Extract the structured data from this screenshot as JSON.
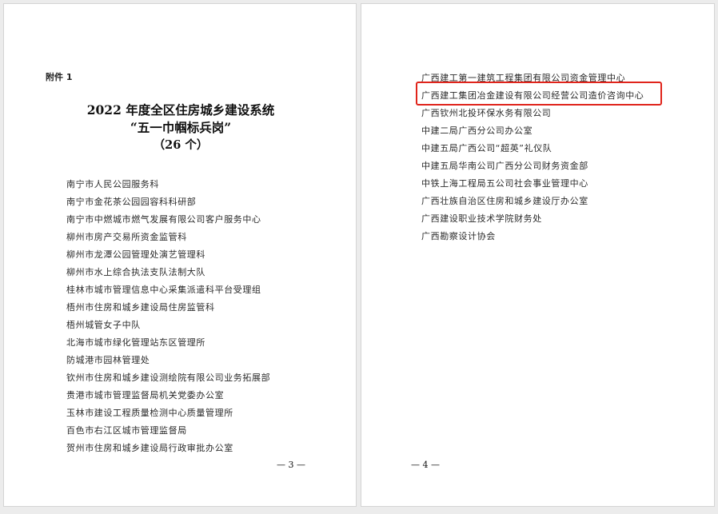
{
  "left_page": {
    "attachment_label": "附件 1",
    "title_line1": "2022 年度全区住房城乡建设系统",
    "title_line2": "“五一巾帼标兵岗”",
    "title_line3": "（26 个）",
    "items": [
      "南宁市人民公园服务科",
      "南宁市金花茶公园园容科科研部",
      "南宁市中燃城市燃气发展有限公司客户服务中心",
      "柳州市房产交易所资金监管科",
      "柳州市龙潭公园管理处演艺管理科",
      "柳州市水上综合执法支队法制大队",
      "桂林市城市管理信息中心采集派遣科平台受理组",
      "梧州市住房和城乡建设局住房监管科",
      "梧州城管女子中队",
      "北海市城市绿化管理站东区管理所",
      "防城港市园林管理处",
      "钦州市住房和城乡建设测绘院有限公司业务拓展部",
      "贵港市城市管理监督局机关党委办公室",
      "玉林市建设工程质量检测中心质量管理所",
      "百色市右江区城市管理监督局",
      "贺州市住房和城乡建设局行政审批办公室"
    ],
    "page_number": "— 3 —"
  },
  "right_page": {
    "items": [
      "广西建工第一建筑工程集团有限公司资金管理中心",
      "广西建工集团冶金建设有限公司经营公司造价咨询中心",
      "广西钦州北投环保水务有限公司",
      "中建二局广西分公司办公室",
      "中建五局广西公司“超英”礼仪队",
      "中建五局华南公司广西分公司财务资金部",
      "中铁上海工程局五公司社会事业管理中心",
      "广西壮族自治区住房和城乡建设厅办公室",
      "广西建设职业技术学院财务处",
      "广西勘察设计协会"
    ],
    "highlighted_item_index": 1,
    "page_number": "— 4 —"
  },
  "colors": {
    "highlight_border": "#e0241b",
    "page_background": "#ffffff",
    "canvas_background": "#ececec"
  }
}
